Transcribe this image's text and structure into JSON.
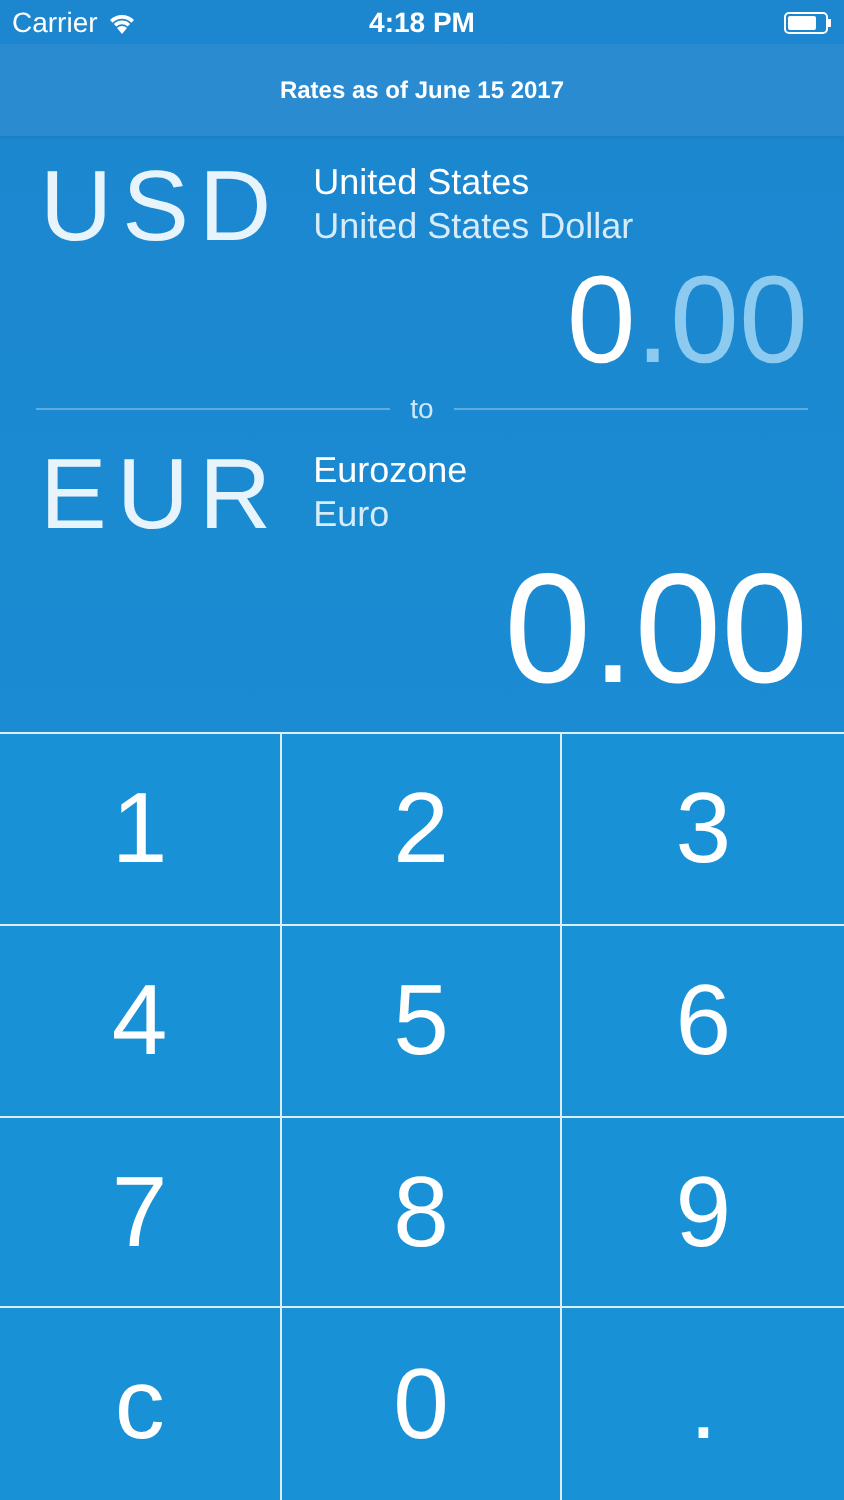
{
  "status_bar": {
    "carrier": "Carrier",
    "time": "4:18 PM"
  },
  "header": {
    "title": "Rates as of June 15 2017"
  },
  "from": {
    "code": "USD",
    "region": "United States",
    "currency": "United States Dollar",
    "amount": {
      "whole": "0",
      "decimals": ".00",
      "decimals_dim": true
    }
  },
  "separator": "to",
  "to": {
    "code": "EUR",
    "region": "Eurozone",
    "currency": "Euro",
    "amount": {
      "whole": "0",
      "decimals": ".00",
      "decimals_dim": false
    }
  },
  "keypad": [
    "1",
    "2",
    "3",
    "4",
    "5",
    "6",
    "7",
    "8",
    "9",
    "c",
    "0",
    "."
  ]
}
